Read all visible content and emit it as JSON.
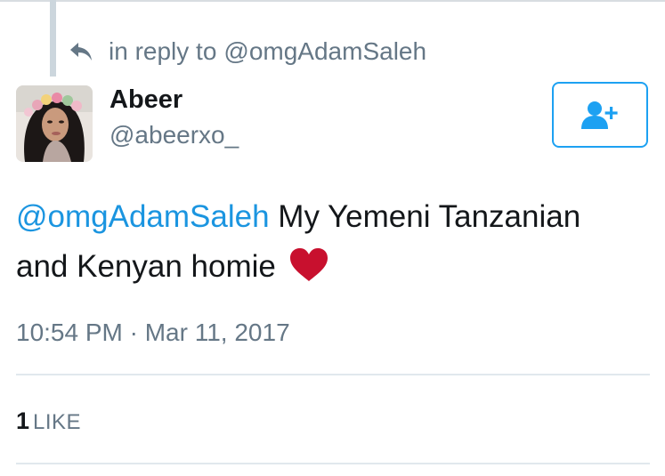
{
  "reply_context": {
    "prefix": "in reply to",
    "handle": "@omgAdamSaleh"
  },
  "author": {
    "display_name": "Abeer",
    "username": "@abeerxo_",
    "avatar_icon": "user-avatar-photo"
  },
  "follow_button": {
    "icon": "add-user-icon",
    "color": "#1da1f2"
  },
  "tweet": {
    "mention": "@omgAdamSaleh",
    "text_line1": " My Yemeni Tanzanian",
    "text_line2": "and Kenyan homie",
    "emoji_icon": "red-heart-icon",
    "emoji_color": "#c8102e"
  },
  "timestamp": "10:54 PM · Mar 11, 2017",
  "engagement": {
    "likes_count": "1",
    "likes_label": "LIKE"
  },
  "colors": {
    "link": "#1b95e0",
    "secondary_text": "#657786",
    "primary_text": "#14171a",
    "divider": "#e1e8ed"
  }
}
